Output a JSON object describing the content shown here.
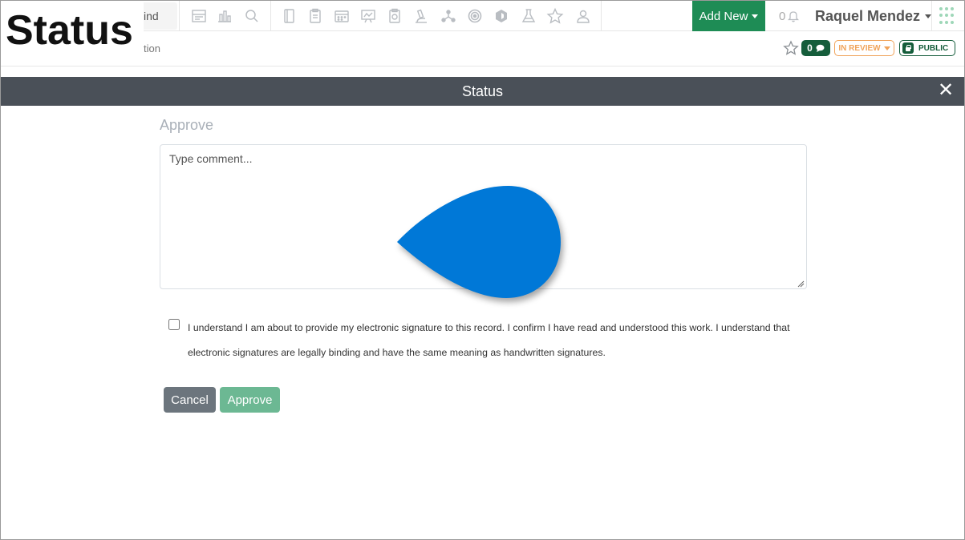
{
  "overlay": {
    "title": "Status"
  },
  "navbar": {
    "find_fragment": "ind",
    "add_new_label": "Add New",
    "notification_count": "0",
    "user_name": "Raquel Mendez",
    "icons": [
      "report-icon",
      "chart-icon",
      "search-icon",
      "notebook-icon",
      "clipboard-icon",
      "calendar-icon",
      "presentation-icon",
      "sample-icon",
      "microscope-icon",
      "network-icon",
      "target-icon",
      "cube-icon",
      "flask-icon",
      "star-icon",
      "users-icon"
    ]
  },
  "subbar": {
    "breadcrumb_fragment": "tion",
    "comment_count": "0",
    "review_status": "IN REVIEW",
    "visibility": "PUBLIC"
  },
  "modal": {
    "title": "Status",
    "close_glyph": "✕",
    "heading": "Approve",
    "comment_placeholder": "Type comment...",
    "signature_text": "I understand I am about to provide my electronic signature to this record. I confirm I have read and understood this work. I understand that electronic signatures are legally binding and have the same meaning as handwritten signatures.",
    "cancel_label": "Cancel",
    "approve_label": "Approve"
  },
  "colors": {
    "accent_green": "#1e8c55",
    "dark_green": "#155d3b",
    "review_orange": "#f0a35a",
    "modal_header": "#4a5058",
    "approve_button": "#6cb893",
    "cancel_button": "#6c757d",
    "cursor_blue": "#0078d7"
  }
}
